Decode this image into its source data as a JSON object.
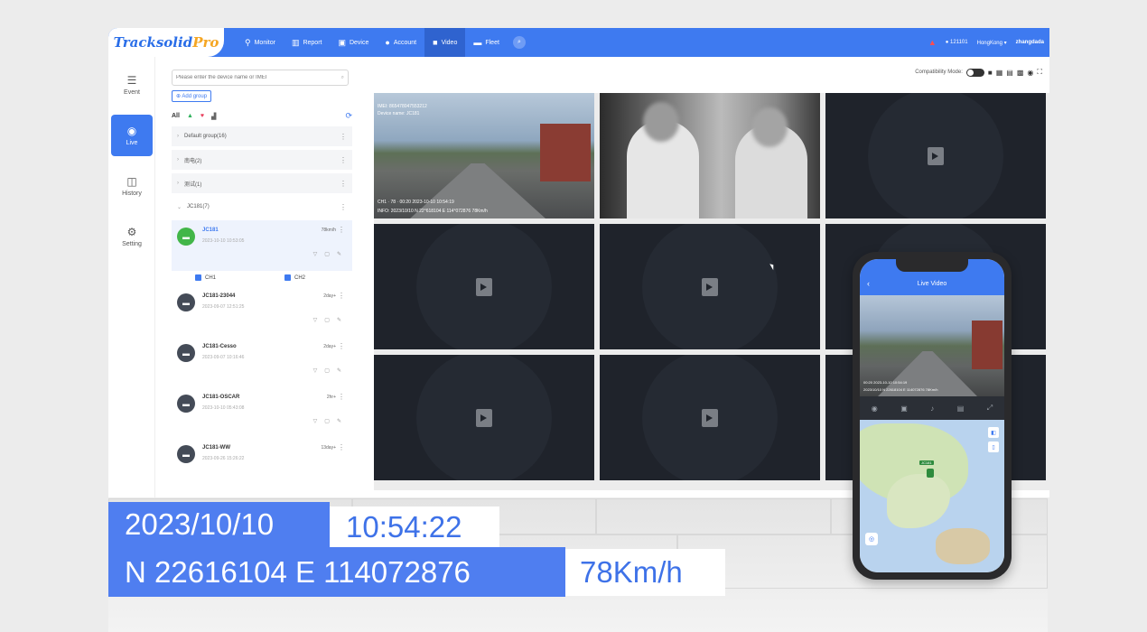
{
  "app": {
    "logo_main": "Tracksolid",
    "logo_accent": "Pro"
  },
  "nav": {
    "items": [
      {
        "label": "Monitor",
        "icon": "pin-icon"
      },
      {
        "label": "Report",
        "icon": "chart-icon"
      },
      {
        "label": "Device",
        "icon": "device-icon"
      },
      {
        "label": "Account",
        "icon": "user-icon"
      },
      {
        "label": "Video",
        "icon": "camera-icon"
      },
      {
        "label": "Fleet",
        "icon": "car-icon"
      }
    ],
    "active": "Video",
    "account_id": "121101",
    "region": "HongKong",
    "username": "zhangdada"
  },
  "rail": {
    "items": [
      {
        "label": "Event",
        "icon": "event-icon"
      },
      {
        "label": "Live",
        "icon": "live-icon"
      },
      {
        "label": "History",
        "icon": "history-icon"
      },
      {
        "label": "Setting",
        "icon": "setting-icon"
      }
    ],
    "active": "Live"
  },
  "devices": {
    "search_placeholder": "Please enter the device name or IMEI",
    "add_group": "Add group",
    "filter_all": "All",
    "groups": [
      {
        "label": "Default group(16)"
      },
      {
        "label": "南电(2)"
      },
      {
        "label": "测试(1)"
      },
      {
        "label": "JC181(7)"
      }
    ],
    "list": [
      {
        "name": "JC181",
        "time": "2023-10-10 10:53:05",
        "status": "78km/h"
      },
      {
        "name": "JC181-23044",
        "time": "2023-09-07 12:51:25",
        "status": "2day+"
      },
      {
        "name": "JC181-Cesso",
        "time": "2023-09-07 10:16:46",
        "status": "2day+"
      },
      {
        "name": "JC181-OSCAR",
        "time": "2023-10-10 05:43:08",
        "status": "2hr+"
      },
      {
        "name": "JC181-WW",
        "time": "2023-09-26 15:26:22",
        "status": "13day+"
      }
    ],
    "channels": [
      "CH1",
      "CH2"
    ]
  },
  "video": {
    "compat_label": "Compatibility Mode:",
    "feed1": {
      "imei": "IMEI: 865478047553212",
      "device": "Device name: JC181",
      "ch": "CH1  · 78 · 00:20  2023-10-10 10:54:19",
      "coord": "INFO: 2023/10/10 N 22°618104 E 114°072876  78Km/h"
    }
  },
  "overlay": {
    "date": "2023/10/10",
    "time": "10:54:22",
    "coord": "N 22616104  E 114072876",
    "speed": "78Km/h"
  },
  "phone": {
    "title": "Live Video",
    "osd_top": "00:20  2023-10-10 10:54:19",
    "osd_bottom": "2023/10/10 N 22618104 E 114072876 78Km/h",
    "map_label": "JC181"
  }
}
